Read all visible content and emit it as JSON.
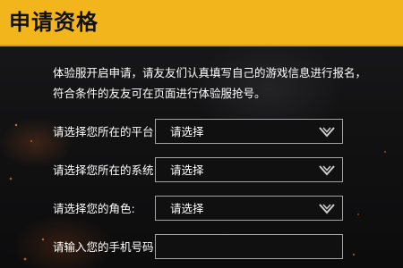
{
  "header": {
    "title": "申请资格",
    "color": "#f2b51c"
  },
  "intro": {
    "line1": "体验服开启申请，请友友们认真填写自己的游戏信息进行报名，",
    "line2": "符合条件的友友可在页面进行体验服抢号。"
  },
  "form": {
    "platform": {
      "label": "请选择您所在的平台:",
      "value": "请选择",
      "icon": "chevron-down-icon"
    },
    "system": {
      "label": "请选择您所在的系统:",
      "value": "请选择",
      "icon": "chevron-down-icon"
    },
    "role": {
      "label": "请选择您的角色:",
      "value": "请选择",
      "icon": "chevron-down-icon"
    },
    "phone": {
      "label": "请输入您的手机号码:",
      "value": ""
    }
  }
}
